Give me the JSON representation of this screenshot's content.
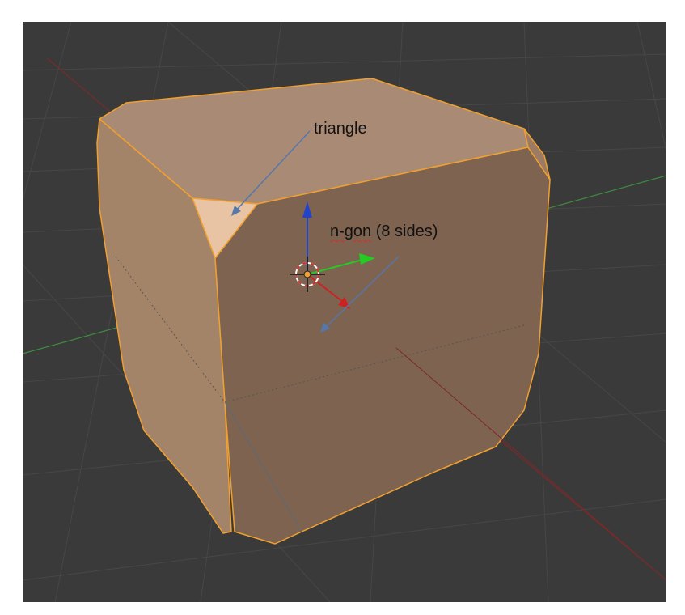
{
  "viewport": {
    "background_color": "#3a3a3a",
    "grid_color": "#454545",
    "x_axis_color": "#8a2a2a",
    "y_axis_color": "#3f8a3f",
    "mesh_selected_edge_color": "#f0a030"
  },
  "annotations": {
    "triangle": "triangle",
    "ngon_word": "n-gon",
    "ngon_rest": " (8 sides)"
  },
  "arrow_color": "#5577aa",
  "gizmo": {
    "z_color": "#2244cc",
    "y_color": "#22cc22",
    "x_color": "#cc2222",
    "pivot_icon": "3d-cursor-icon"
  }
}
